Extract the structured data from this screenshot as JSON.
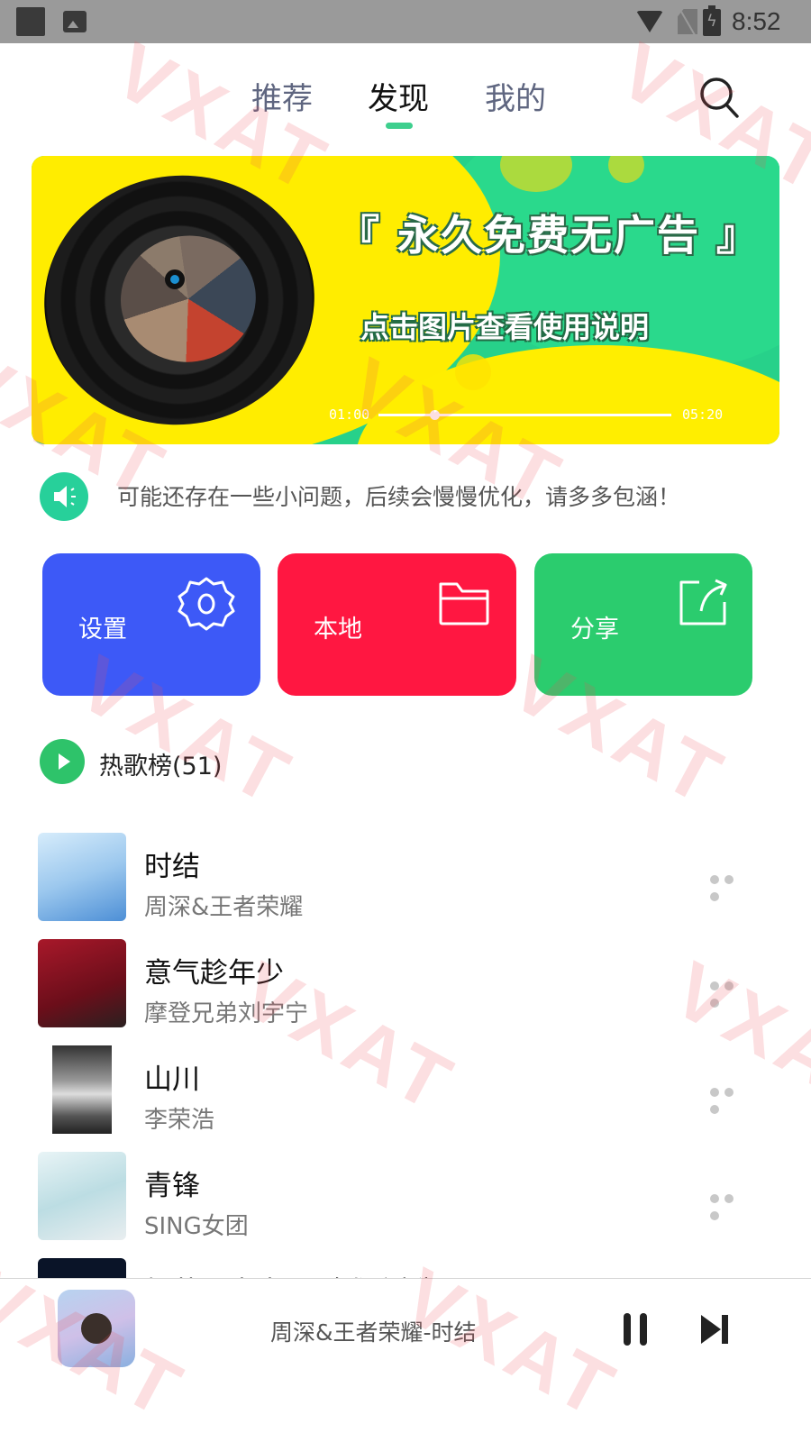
{
  "status_bar": {
    "time": "8:52"
  },
  "nav": {
    "tabs": [
      {
        "label": "推荐",
        "active": false
      },
      {
        "label": "发现",
        "active": true
      },
      {
        "label": "我的",
        "active": false
      }
    ],
    "accent_color": "#3ecf8e"
  },
  "banner": {
    "title": "『 永久免费无广告 』",
    "subtitle": "点击图片查看使用说明",
    "time_start": "01:00",
    "time_end": "05:20",
    "progress": 0.19
  },
  "notice": {
    "text": "可能还存在一些小问题，后续会慢慢优化，请多多包涵！"
  },
  "actions": [
    {
      "label": "设置",
      "icon": "gear-icon",
      "color": "#3d59f7"
    },
    {
      "label": "本地",
      "icon": "folder-icon",
      "color": "#ff1741"
    },
    {
      "label": "分享",
      "icon": "share-icon",
      "color": "#2bcc6e"
    }
  ],
  "section": {
    "title": "热歌榜(51)"
  },
  "songs": [
    {
      "title": "时结",
      "artist": "周深&王者荣耀"
    },
    {
      "title": "意气趁年少",
      "artist": "摩登兄弟刘宇宁"
    },
    {
      "title": "山川",
      "artist": "李荣浩"
    },
    {
      "title": "青锋",
      "artist": "SING女团"
    },
    {
      "title": "邹若丽毒去了（戏腔版）",
      "artist": ""
    }
  ],
  "mini_player": {
    "now_playing": "周深&王者荣耀-时结"
  },
  "watermark": {
    "text": "VXAT"
  }
}
